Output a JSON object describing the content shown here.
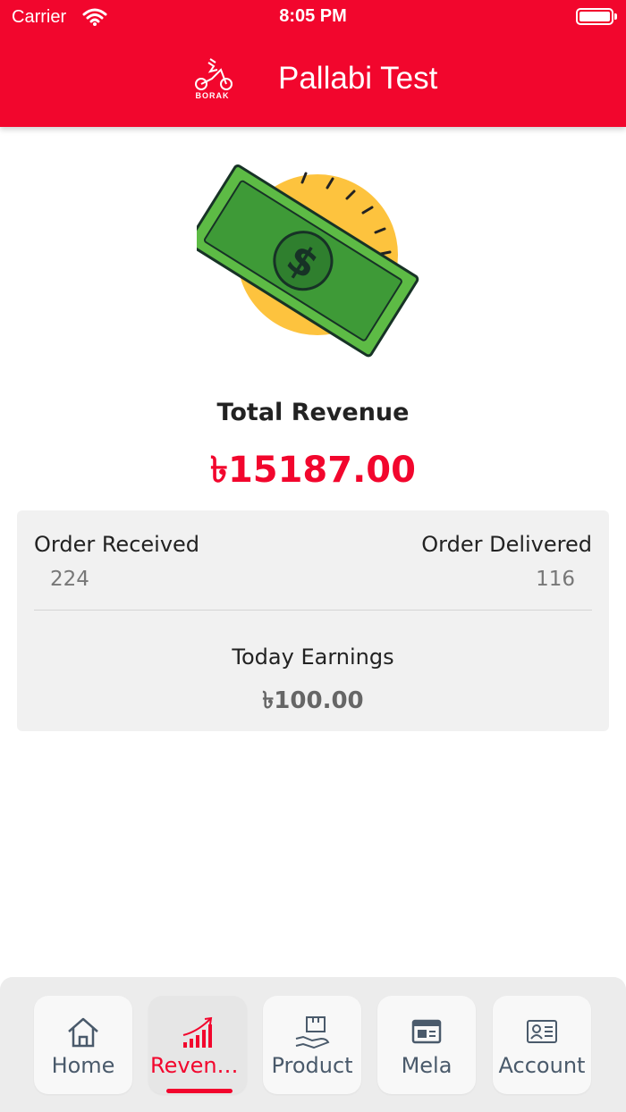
{
  "status_bar": {
    "carrier": "Carrier",
    "time": "8:05 PM"
  },
  "header": {
    "logo_text": "BORAK",
    "title": "Pallabi Test"
  },
  "revenue": {
    "label": "Total Revenue",
    "value": "৳15187.00"
  },
  "stats": {
    "order_received_label": "Order Received",
    "order_received_value": "224",
    "order_delivered_label": "Order Delivered",
    "order_delivered_value": "116",
    "today_label": "Today Earnings",
    "today_value": "৳100.00"
  },
  "bottom_nav": {
    "tabs": [
      {
        "label": "Home",
        "icon": "home-icon"
      },
      {
        "label": "Revenu...",
        "icon": "chart-up-icon"
      },
      {
        "label": "Product",
        "icon": "product-box-icon"
      },
      {
        "label": "Mela",
        "icon": "browser-window-icon"
      },
      {
        "label": "Account",
        "icon": "id-card-icon"
      }
    ],
    "active_index": 1
  },
  "colors": {
    "brand": "#f2062d",
    "card": "#f1f1f1",
    "nav_text": "#4a5a6b"
  }
}
